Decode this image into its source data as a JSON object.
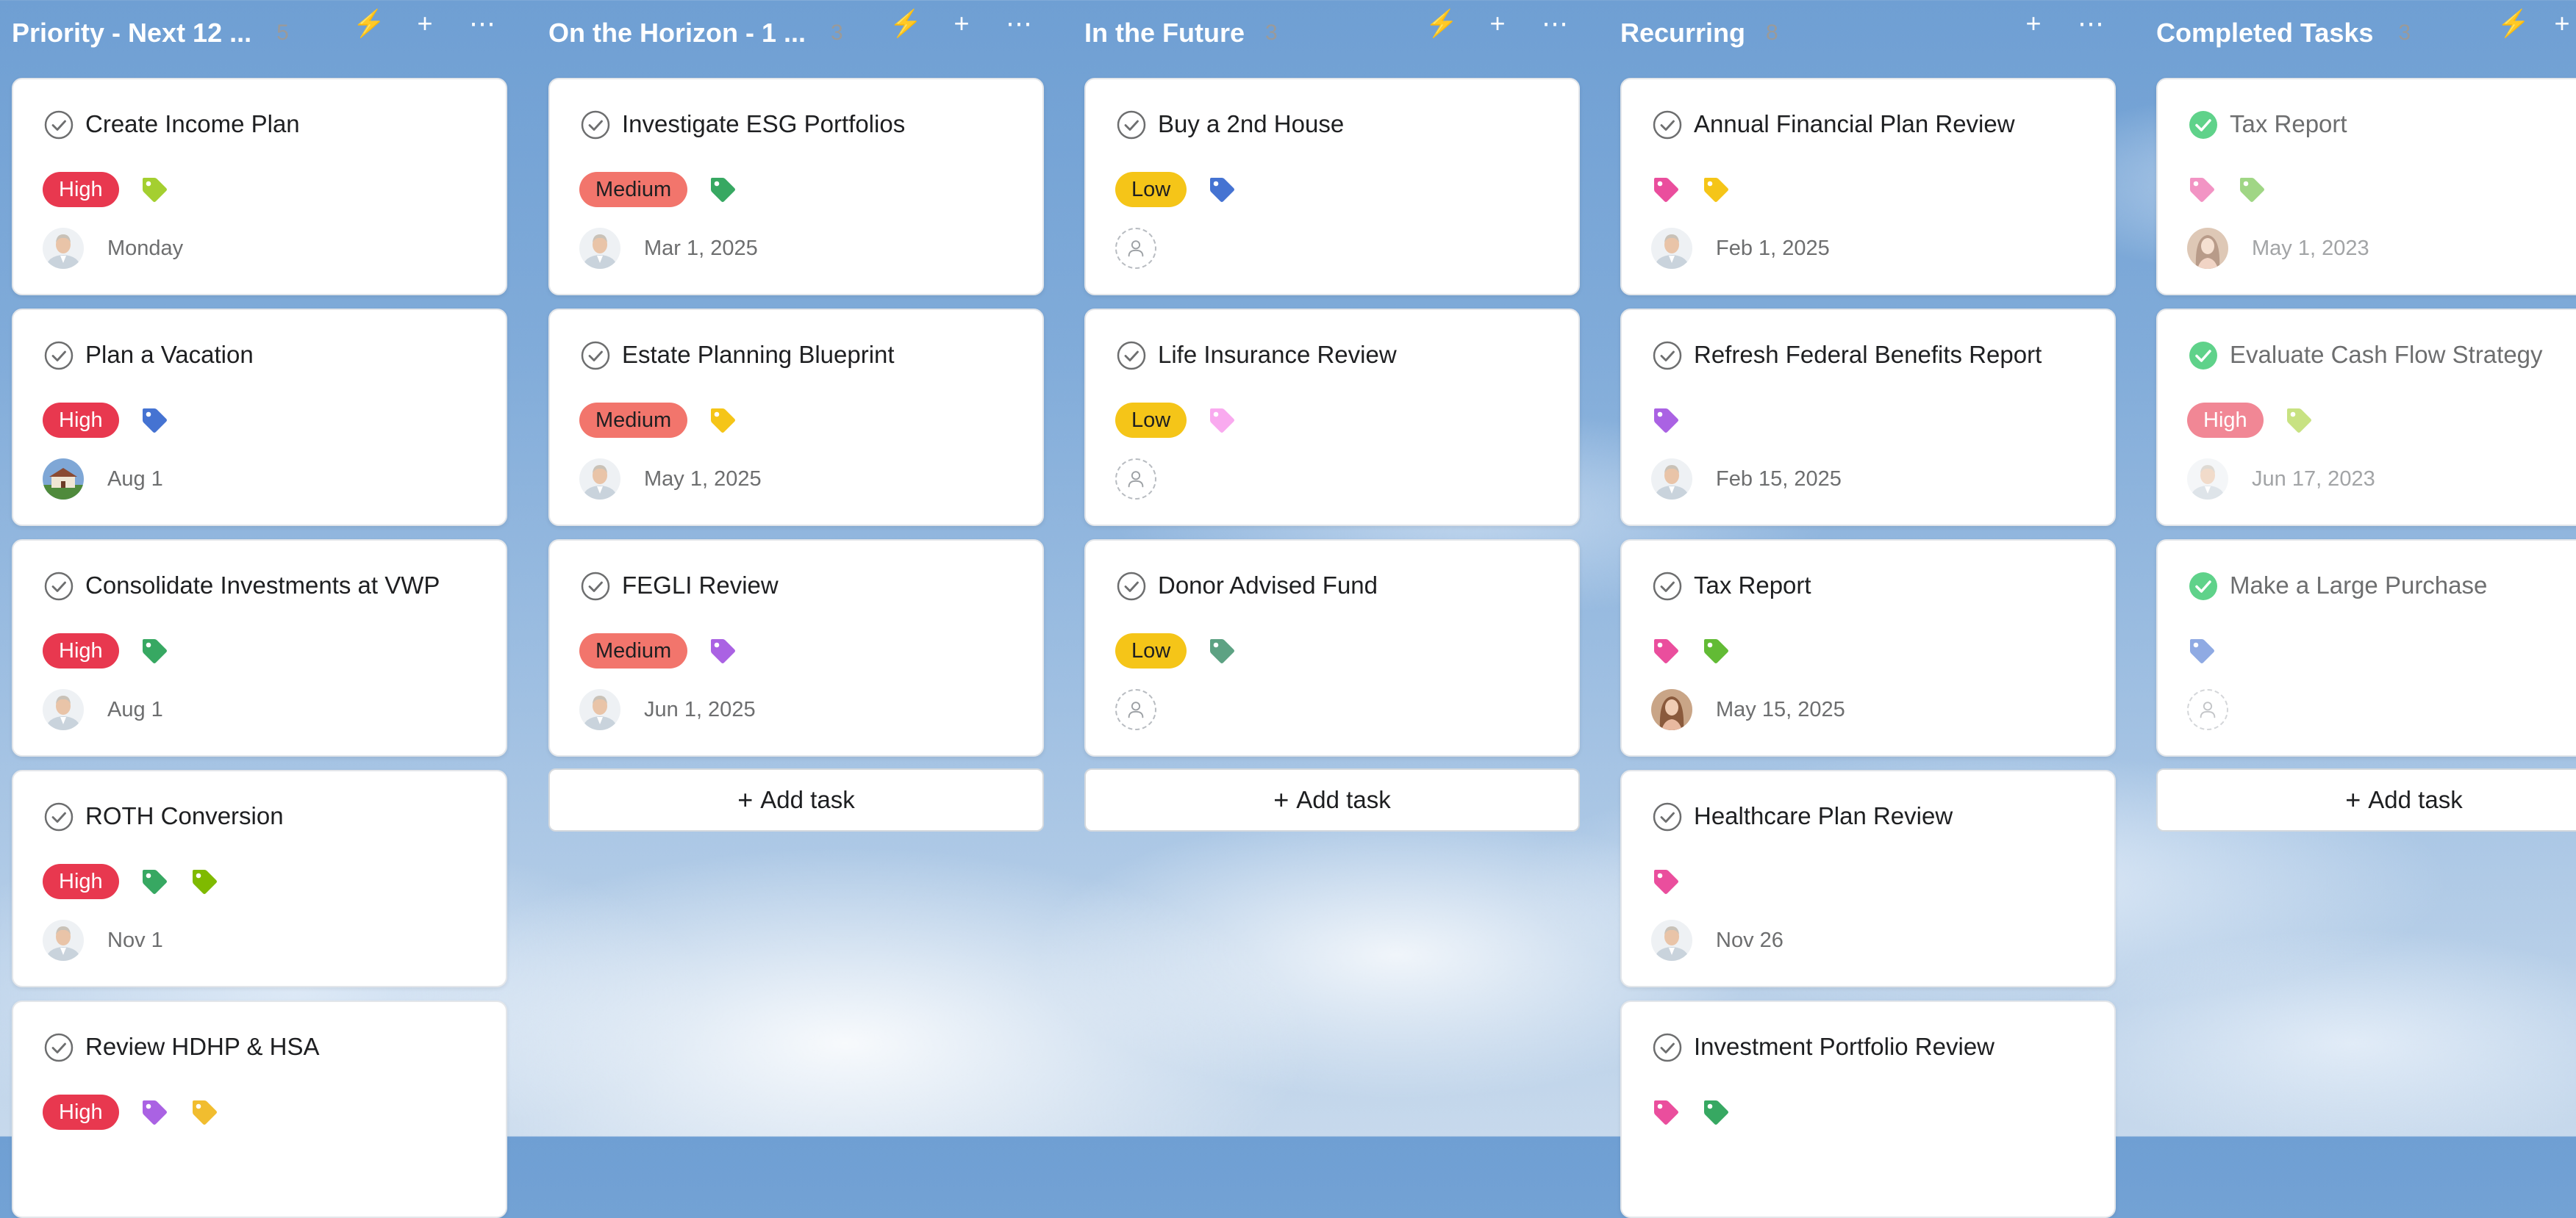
{
  "colors": {
    "priority_high": "#e8384f",
    "priority_medium": "#f2756c",
    "priority_low": "#f5c518",
    "bolt": "#f4d12a",
    "complete_check": "#5fd28a"
  },
  "add_task_label": "Add task",
  "columns": [
    {
      "title": "Priority - Next 12 ...",
      "count": "5",
      "has_bolt": true,
      "show_add_task": false,
      "tasks": [
        {
          "name": "Create Income Plan",
          "priority": "High",
          "tags": [
            "#a4cf30"
          ],
          "avatar": "man",
          "due": "Monday"
        },
        {
          "name": "Plan a Vacation",
          "priority": "High",
          "tags": [
            "#4573d2"
          ],
          "avatar": "house",
          "due": "Aug 1"
        },
        {
          "name": "Consolidate Investments at VWP",
          "priority": "High",
          "tags": [
            "#37a862"
          ],
          "avatar": "man",
          "due": "Aug 1"
        },
        {
          "name": "ROTH Conversion",
          "priority": "High",
          "tags": [
            "#37a862",
            "#7fba00"
          ],
          "avatar": "man",
          "due": "Nov 1"
        },
        {
          "name": "Review HDHP & HSA",
          "priority": "High",
          "tags": [
            "#aa62e3",
            "#f1bd2f"
          ],
          "avatar": "none",
          "due": ""
        }
      ]
    },
    {
      "title": "On the Horizon - 1 ...",
      "count": "3",
      "has_bolt": true,
      "show_add_task": true,
      "tasks": [
        {
          "name": "Investigate ESG Portfolios",
          "priority": "Medium",
          "tags": [
            "#37a862"
          ],
          "avatar": "man",
          "due": "Mar 1, 2025"
        },
        {
          "name": "Estate Planning Blueprint",
          "priority": "Medium",
          "tags": [
            "#f5c518"
          ],
          "avatar": "man",
          "due": "May 1, 2025"
        },
        {
          "name": "FEGLI Review",
          "priority": "Medium",
          "tags": [
            "#aa62e3"
          ],
          "avatar": "man",
          "due": "Jun 1, 2025"
        }
      ]
    },
    {
      "title": "In the Future",
      "count": "3",
      "has_bolt": true,
      "show_add_task": true,
      "tasks": [
        {
          "name": "Buy a 2nd House",
          "priority": "Low",
          "tags": [
            "#4573d2"
          ],
          "avatar": "empty",
          "due": ""
        },
        {
          "name": "Life Insurance Review",
          "priority": "Low",
          "tags": [
            "#f9aaef"
          ],
          "avatar": "empty",
          "due": ""
        },
        {
          "name": "Donor Advised Fund",
          "priority": "Low",
          "tags": [
            "#5da283"
          ],
          "avatar": "empty",
          "due": ""
        }
      ]
    },
    {
      "title": "Recurring",
      "count": "8",
      "has_bolt": false,
      "show_add_task": false,
      "tasks": [
        {
          "name": "Annual Financial Plan Review",
          "priority": "",
          "tags": [
            "#ea4e9d",
            "#f5c518"
          ],
          "avatar": "man",
          "due": "Feb 1, 2025"
        },
        {
          "name": "Refresh Federal Benefits Report",
          "priority": "",
          "tags": [
            "#aa62e3"
          ],
          "avatar": "man",
          "due": "Feb 15, 2025"
        },
        {
          "name": "Tax Report",
          "priority": "",
          "tags": [
            "#ea4e9d",
            "#62bb35"
          ],
          "avatar": "woman",
          "due": "May 15, 2025"
        },
        {
          "name": "Healthcare Plan Review",
          "priority": "",
          "tags": [
            "#ea4e9d"
          ],
          "avatar": "man",
          "due": "Nov 26"
        },
        {
          "name": "Investment Portfolio Review",
          "priority": "",
          "tags": [
            "#ea4e9d",
            "#37a862"
          ],
          "avatar": "none",
          "due": ""
        }
      ]
    },
    {
      "title": "Completed Tasks",
      "count": "3",
      "has_bolt": true,
      "show_add_task": true,
      "tasks": [
        {
          "name": "Tax Report",
          "priority": "",
          "tags": [
            "#ea4e9d",
            "#62bb35"
          ],
          "avatar": "woman",
          "due": "May 1, 2023",
          "completed": true
        },
        {
          "name": "Evaluate Cash Flow Strategy",
          "priority": "High",
          "tags": [
            "#a4cf30"
          ],
          "avatar": "man",
          "due": "Jun 17, 2023",
          "completed": true
        },
        {
          "name": "Make a Large Purchase",
          "priority": "",
          "tags": [
            "#4573d2"
          ],
          "avatar": "empty",
          "due": "",
          "completed": true
        }
      ]
    }
  ]
}
